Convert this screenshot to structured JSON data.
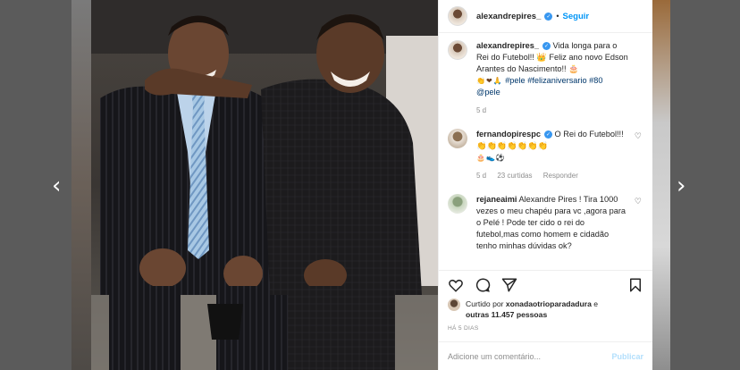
{
  "colors": {
    "link": "#0095f6",
    "verified": "#3897f0",
    "hashtag": "#00376b",
    "muted": "#8e8e8e"
  },
  "nav": {
    "prev_icon": "chevron-left-icon",
    "next_icon": "chevron-right-icon",
    "prev": "‹",
    "next": "›"
  },
  "header": {
    "username": "alexandrepires_",
    "separator": "•",
    "follow_label": "Seguir"
  },
  "caption": {
    "username": "alexandrepires_",
    "text": "Vida longa para o Rei do Futebol!! 👑 Feliz ano novo Edson Arantes do Nascimento!! 🎂",
    "emojis": "👏❤🙏",
    "hashtags": "#pele #felizaniversario #80",
    "mention": "@pele",
    "age": "5 d"
  },
  "comments": [
    {
      "username": "fernandopirespc",
      "text": "O Rei do Futebol!!! 👏👏👏👏👏👏👏",
      "emojis": "🎂👟⚽",
      "age": "5 d",
      "likes": "23 curtidas",
      "reply": "Responder"
    },
    {
      "username": "rejaneaimi",
      "text": "Alexandre Pires ! Tira 1000 vezes o meu chapéu para vc ,agora para o Pelé ! Pode ter cido o rei do futebol,mas como homem e cidadão tenho minhas dúvidas ok?"
    }
  ],
  "likes": {
    "prefix": "Curtido por",
    "user": "xonadaotrioparadadura",
    "middle": "e",
    "others": "outras 11.457 pessoas"
  },
  "timestamp": "HÁ 5 DIAS",
  "add_comment": {
    "placeholder": "Adicione um comentário...",
    "publish_label": "Publicar"
  }
}
